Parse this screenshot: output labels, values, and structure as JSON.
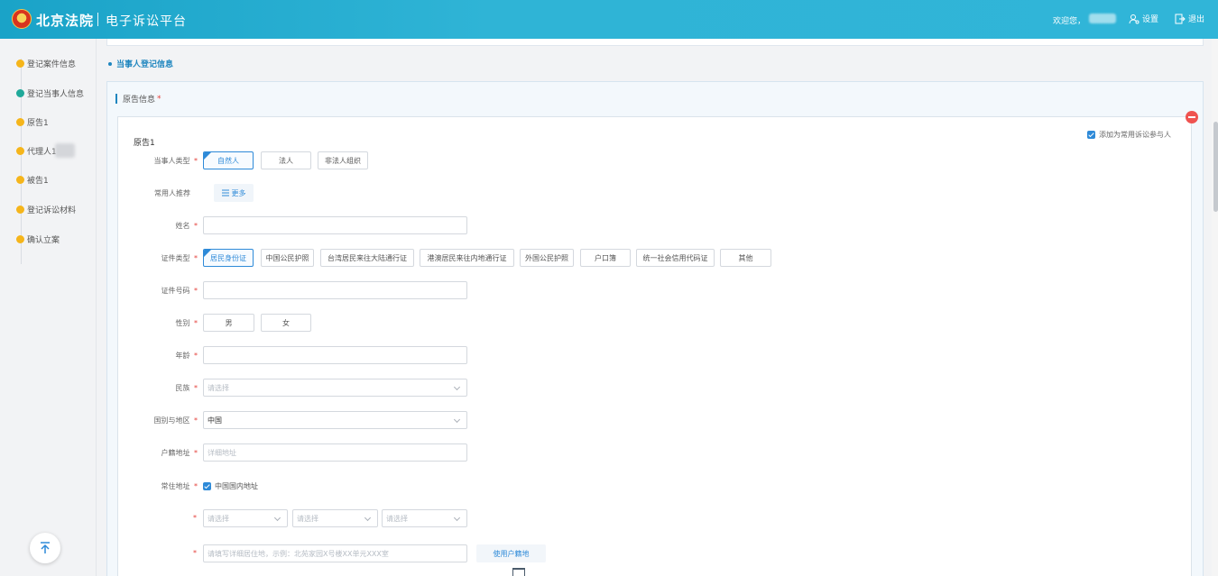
{
  "header": {
    "logo_text": "北京法院",
    "platform_title": "电子诉讼平台",
    "welcome": "欢迎您，",
    "settings_label": "设置",
    "logout_label": "退出"
  },
  "sidebar": {
    "steps": [
      {
        "label": "登记案件信息",
        "status": "yellow"
      },
      {
        "label": "登记当事人信息",
        "status": "green"
      },
      {
        "label": "原告1",
        "status": "yellow"
      },
      {
        "label": "代理人1",
        "status": "yellow"
      },
      {
        "label": "被告1",
        "status": "yellow"
      },
      {
        "label": "登记诉讼材料",
        "status": "yellow"
      },
      {
        "label": "确认立案",
        "status": "yellow"
      }
    ]
  },
  "section": {
    "title": "当事人登记信息"
  },
  "panel": {
    "title": "原告信息",
    "required_mark": "*"
  },
  "card": {
    "title": "原告1",
    "add_frequent_label": "添加为常用诉讼参与人",
    "add_frequent_checked": true
  },
  "form": {
    "party_type": {
      "label": "当事人类型",
      "options": [
        "自然人",
        "法人",
        "非法人组织"
      ],
      "selected": "自然人"
    },
    "frequent": {
      "label": "常用人推荐",
      "more_label": "更多"
    },
    "name": {
      "label": "姓名",
      "value": ""
    },
    "id_type": {
      "label": "证件类型",
      "options": [
        "居民身份证",
        "中国公民护照",
        "台湾居民来往大陆通行证",
        "港澳居民来往内地通行证",
        "外国公民护照",
        "户口簿",
        "统一社会信用代码证",
        "其他"
      ],
      "selected": "居民身份证"
    },
    "id_number": {
      "label": "证件号码",
      "value": ""
    },
    "gender": {
      "label": "性别",
      "options": [
        "男",
        "女"
      ]
    },
    "age": {
      "label": "年龄",
      "value": ""
    },
    "ethnicity": {
      "label": "民族",
      "placeholder": "请选择"
    },
    "country": {
      "label": "国别与地区",
      "value": "中国"
    },
    "hukou": {
      "label": "户籍地址",
      "placeholder": "详细地址"
    },
    "residence": {
      "label": "常住地址",
      "domestic_label": "中国国内地址",
      "domestic_checked": true,
      "province_placeholder": "请选择",
      "city_placeholder": "请选择",
      "district_placeholder": "请选择",
      "detail_placeholder": "请填写详细居住地，示例：北苑家园X号楼XX单元XXX室",
      "use_hukou_label": "使用户籍地"
    },
    "required_mark": "*"
  },
  "colors": {
    "header": "#2fb4d6",
    "accent": "#2e8ad8",
    "required": "#e5413b",
    "step_yellow": "#f5b51b",
    "step_green": "#20a99a"
  }
}
